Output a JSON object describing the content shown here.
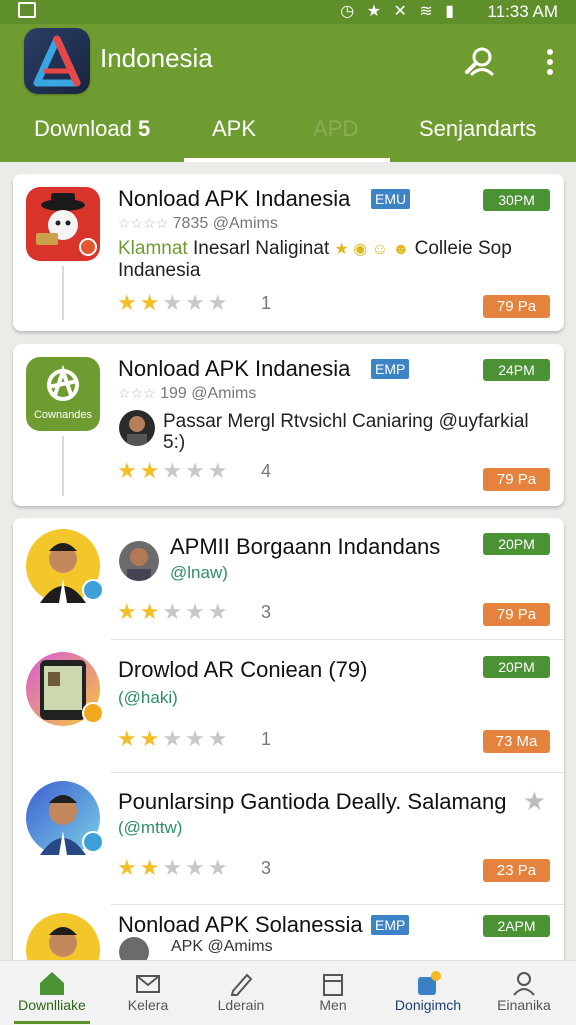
{
  "status": {
    "time": "11:33 AM"
  },
  "app": {
    "title": "Indonesia"
  },
  "tabs": [
    {
      "label": "Download",
      "suffix": "5"
    },
    {
      "label": "APK"
    },
    {
      "label": "APD"
    },
    {
      "label": "Senjandarts"
    }
  ],
  "items": [
    {
      "title": "Nonload APK Indanesia",
      "tag": "EMU",
      "sub": "7835 @Amims",
      "desc_title": "Klamnat",
      "desc": "Inesarl Naliginat",
      "desc_line2": "Colleie Sop",
      "desc_line3": "Indanesia",
      "rating_count": "1",
      "time": "30PM",
      "price": "79 Pa"
    },
    {
      "title": "Nonload APK Indanesia",
      "tag": "EMP",
      "sub": "199 @Amims",
      "desc": "Passar Mergl Rtvsichl Caniaring @uyfarkial",
      "desc_line2": "5:)",
      "thumb_label": "Cownandes",
      "rating_count": "4",
      "time": "24PM",
      "price": "79 Pa"
    },
    {
      "title": "APMII Borgaann Indandans",
      "handle": "@lnaw)",
      "rating_count": "3",
      "time": "20PM",
      "price": "79 Pa"
    },
    {
      "title": "Drowlod AR Coniean (79)",
      "handle": "(@haki)",
      "rating_count": "1",
      "time": "20PM",
      "price": "73 Ma"
    },
    {
      "title": "Pounlarsinp Gantioda Deally. Salamang",
      "handle": "(@mttw)",
      "rating_count": "3",
      "price": "23 Pa"
    },
    {
      "title": "Nonload APK Solanessia",
      "tag": "EMP",
      "sub": "APK @Amims",
      "time": "2APM"
    }
  ],
  "bottom_nav": [
    {
      "label": "Downlliake"
    },
    {
      "label": "Kelera"
    },
    {
      "label": "Lderain"
    },
    {
      "label": "Men"
    },
    {
      "label": "Donigimch"
    },
    {
      "label": "Einanika"
    }
  ],
  "colors": {
    "brand": "#6f9c31",
    "status_bar": "#5f8f2a",
    "time_badge": "#4b9234",
    "price_badge": "#e4823e",
    "tag": "#3d84c6"
  }
}
